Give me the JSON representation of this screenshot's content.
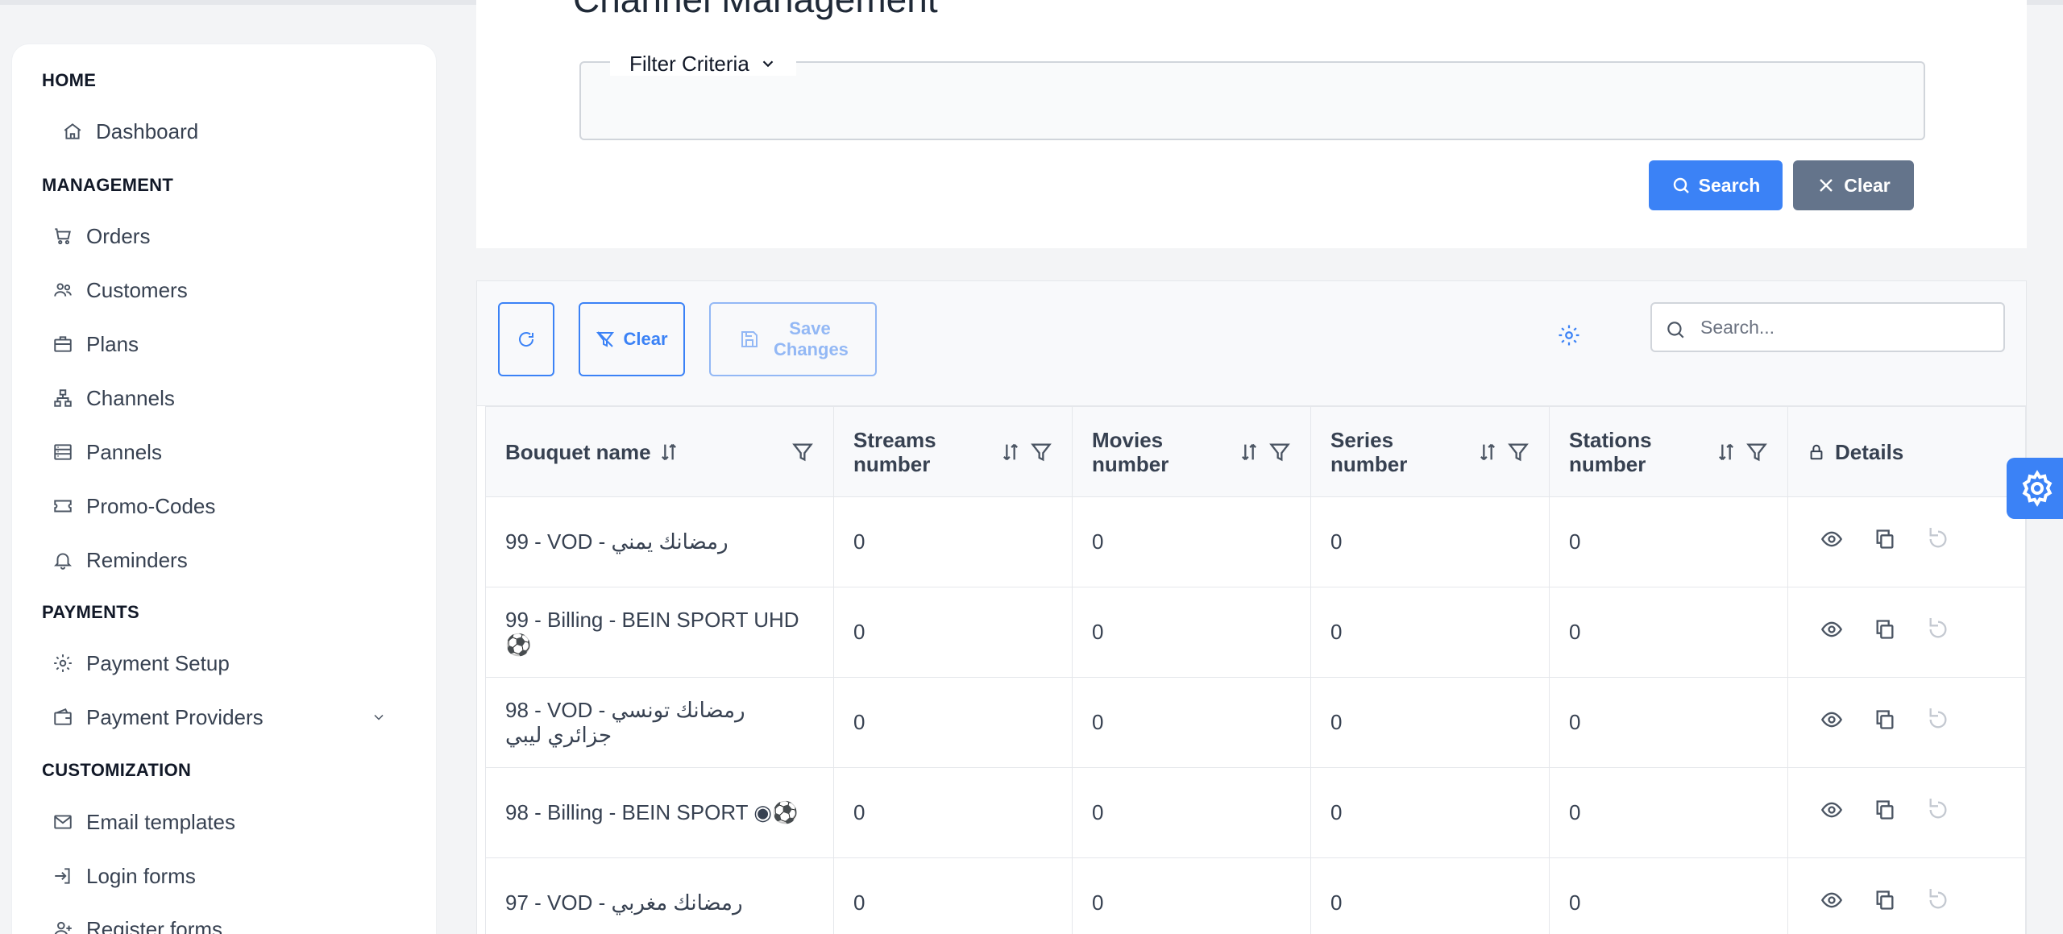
{
  "page": {
    "title": "Channel Management"
  },
  "sidebar": {
    "sections": [
      {
        "label": "HOME",
        "items": [
          {
            "label": "Dashboard",
            "icon": "home-icon"
          }
        ]
      },
      {
        "label": "MANAGEMENT",
        "items": [
          {
            "label": "Orders",
            "icon": "cart-icon"
          },
          {
            "label": "Customers",
            "icon": "users-icon"
          },
          {
            "label": "Plans",
            "icon": "briefcase-icon"
          },
          {
            "label": "Channels",
            "icon": "network-icon"
          },
          {
            "label": "Pannels",
            "icon": "server-icon"
          },
          {
            "label": "Promo-Codes",
            "icon": "ticket-icon"
          },
          {
            "label": "Reminders",
            "icon": "bell-icon"
          }
        ]
      },
      {
        "label": "PAYMENTS",
        "items": [
          {
            "label": "Payment Setup",
            "icon": "gear-icon"
          },
          {
            "label": "Payment Providers",
            "icon": "wallet-icon"
          }
        ]
      },
      {
        "label": "CUSTOMIZATION",
        "items": [
          {
            "label": "Email templates",
            "icon": "mail-icon"
          },
          {
            "label": "Login forms",
            "icon": "login-icon"
          },
          {
            "label": "Register forms",
            "icon": "user-plus-icon"
          }
        ]
      }
    ]
  },
  "filter": {
    "legend": "Filter Criteria",
    "search_label": "Search",
    "clear_label": "Clear"
  },
  "toolbar": {
    "clear_label": "Clear",
    "save_label": "Save Changes",
    "search_placeholder": "Search..."
  },
  "table": {
    "columns": [
      {
        "label": "Bouquet name"
      },
      {
        "label": "Streams number"
      },
      {
        "label": "Movies number"
      },
      {
        "label": "Series number"
      },
      {
        "label": "Stations number"
      },
      {
        "label": "Details"
      }
    ],
    "rows": [
      {
        "name": "99 - VOD - رمضانك يمني",
        "streams": "0",
        "movies": "0",
        "series": "0",
        "stations": "0"
      },
      {
        "name": "99 - Billing - BEIN SPORT UHD⚽",
        "streams": "0",
        "movies": "0",
        "series": "0",
        "stations": "0"
      },
      {
        "name": "98 - VOD - رمضانك تونسي جزائري ليبي",
        "streams": "0",
        "movies": "0",
        "series": "0",
        "stations": "0"
      },
      {
        "name": "98 - Billing - BEIN SPORT ◉⚽",
        "streams": "0",
        "movies": "0",
        "series": "0",
        "stations": "0"
      },
      {
        "name": "97 - VOD - رمضانك مغربي",
        "streams": "0",
        "movies": "0",
        "series": "0",
        "stations": "0"
      }
    ]
  },
  "colors": {
    "primary": "#3b82f6",
    "secondary": "#64748b"
  }
}
